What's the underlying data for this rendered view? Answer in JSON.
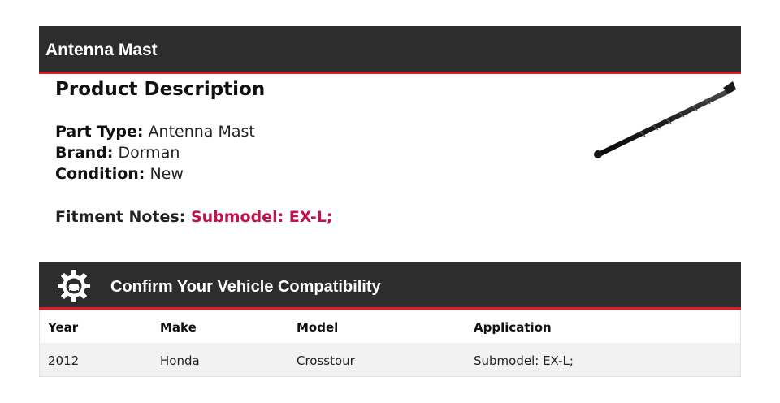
{
  "header": {
    "title": "Antenna Mast"
  },
  "description": {
    "title": "Product Description",
    "specs": [
      {
        "label": "Part Type:",
        "value": "Antenna Mast"
      },
      {
        "label": "Brand:",
        "value": "Dorman"
      },
      {
        "label": "Condition:",
        "value": "New"
      }
    ],
    "fitment": {
      "label": "Fitment Notes:",
      "value": "Submodel: EX-L;"
    }
  },
  "compat": {
    "title": "Confirm Your Vehicle Compatibility",
    "columns": [
      "Year",
      "Make",
      "Model",
      "Application"
    ],
    "rows": [
      [
        "2012",
        "Honda",
        "Crosstour",
        "Submodel: EX-L;"
      ]
    ]
  },
  "colors": {
    "bar": "#2e2d2d",
    "accent": "#e21d24",
    "fitment": "#c0134a"
  },
  "icons": {
    "compat": "gear-car-icon",
    "product": "antenna-mast-image"
  }
}
